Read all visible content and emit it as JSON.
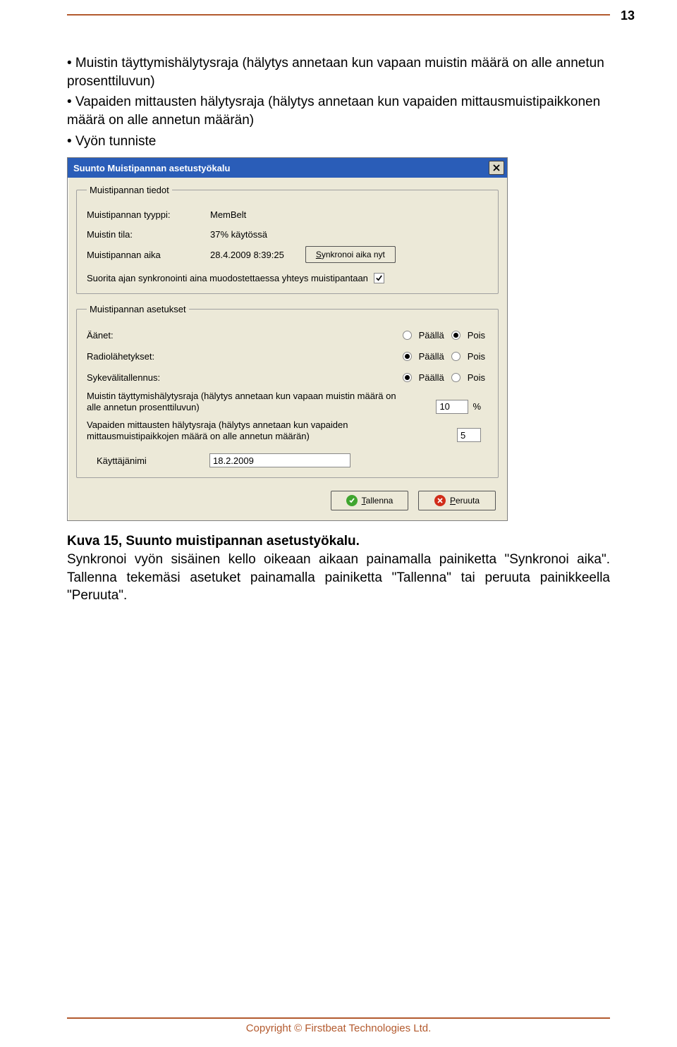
{
  "page_number": "13",
  "intro": {
    "bullet1": "• Muistin täyttymishälytysraja (hälytys annetaan kun vapaan muistin määrä on alle annetun prosenttiluvun)",
    "bullet2": "• Vapaiden mittausten hälytysraja (hälytys annetaan kun vapaiden mittausmuistipaikkonen määrä on alle annetun määrän)",
    "bullet3": "• Vyön tunniste"
  },
  "dialog": {
    "title": "Suunto Muistipannan asetustyökalu",
    "info_legend": "Muistipannan tiedot",
    "type_label": "Muistipannan tyyppi:",
    "type_value": "MemBelt",
    "mem_label": "Muistin tila:",
    "mem_value": "37% käytössä",
    "time_label": "Muistipannan aika",
    "time_value": "28.4.2009 8:39:25",
    "sync_button": "Synkronoi aika nyt",
    "sync_text": "Suorita ajan synkronointi aina muodostettaessa yhteys muistipantaan",
    "settings_legend": "Muistipannan asetukset",
    "sounds_label": "Äänet:",
    "radio_label": "Radiolähetykset:",
    "hr_label": "Sykevälitallennus:",
    "on": "Päällä",
    "off": "Pois",
    "fill_alarm_label": "Muistin täyttymishälytysraja (hälytys annetaan kun vapaan muistin määrä on alle annetun prosenttiluvun)",
    "fill_alarm_value": "10",
    "pct": "%",
    "free_alarm_label": "Vapaiden mittausten hälytysraja (hälytys annetaan kun vapaiden mittausmuistipaikkojen määrä on alle annetun määrän)",
    "free_alarm_value": "5",
    "user_label": "Käyttäjänimi",
    "user_value": "18.2.2009",
    "save_btn": "Tallenna",
    "cancel_btn": "Peruuta",
    "radio_states": {
      "sounds": "Pois",
      "radio": "Päällä",
      "hr": "Päällä"
    },
    "autosync_checked": true
  },
  "caption": {
    "title": "Kuva 15, Suunto muistipannan asetustyökalu.",
    "body": "Synkronoi vyön sisäinen kello oikeaan aikaan painamalla painiketta \"Synkronoi aika\". Tallenna tekemäsi asetuket painamalla painiketta \"Tallenna\" tai peruuta painikkeella \"Peruuta\"."
  },
  "footer": "Copyright © Firstbeat Technologies Ltd."
}
